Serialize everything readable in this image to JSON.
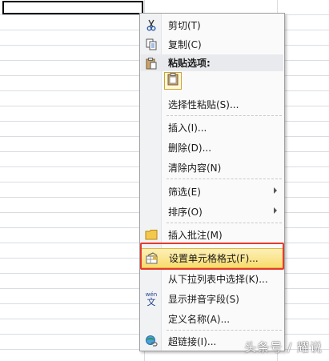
{
  "menu": {
    "items": [
      {
        "label": "剪切(T)",
        "icon": "scissors-icon"
      },
      {
        "label": "复制(C)",
        "icon": "copy-icon"
      },
      {
        "label": "粘贴选项:",
        "icon": "paste-icon"
      },
      {
        "label": "",
        "icon": "paste-clipboard-icon"
      },
      {
        "label": "选择性粘贴(S)...",
        "icon": ""
      },
      {
        "label": "插入(I)...",
        "icon": ""
      },
      {
        "label": "删除(D)...",
        "icon": ""
      },
      {
        "label": "清除内容(N)",
        "icon": ""
      },
      {
        "label": "筛选(E)",
        "icon": ""
      },
      {
        "label": "排序(O)",
        "icon": ""
      },
      {
        "label": "插入批注(M)",
        "icon": "comment-folder-icon"
      },
      {
        "label": "设置单元格格式(F)...",
        "icon": "format-cells-icon"
      },
      {
        "label": "从下拉列表中选择(K)...",
        "icon": ""
      },
      {
        "label": "显示拼音字段(S)",
        "icon": "phonetic-icon"
      },
      {
        "label": "定义名称(A)...",
        "icon": ""
      },
      {
        "label": "超链接(I)...",
        "icon": "hyperlink-icon"
      }
    ]
  },
  "phonetic_icon_text": "wén\n文",
  "watermark": "头条号 / 耀说",
  "colors": {
    "highlight_border": "#e3b73f",
    "annotation_red": "#e33b2f",
    "grid_line": "#d9dde3"
  }
}
